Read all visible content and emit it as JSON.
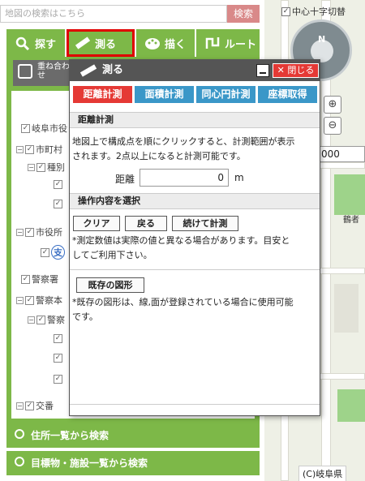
{
  "search": {
    "placeholder": "地図の検索はこちら",
    "button": "検索"
  },
  "map": {
    "cross_toggle": "中心十字切替",
    "compass": "N",
    "input_value": "000",
    "copyright": "(C)岐阜県",
    "place_label": "鶴者"
  },
  "toolbar": {
    "search": "探す",
    "measure": "測る",
    "draw": "描く",
    "route": "ルート"
  },
  "panel": {
    "kasane": "重ね合わせ",
    "hyouji": "表示切",
    "tree": [
      "岐阜市役",
      "市町村",
      "種別",
      "市役所",
      "支",
      "警察署",
      "警察本",
      "警察",
      "交番"
    ]
  },
  "dialog": {
    "title": "測る",
    "close": "閉じる",
    "tabs": [
      "距離計測",
      "面積計測",
      "同心円計測",
      "座標取得"
    ],
    "section1": "距離計測",
    "desc1_line1": "地図上で構成点を順にクリックすると、計測範囲が表示",
    "desc1_line2": "されます。2点以上になると計測可能です。",
    "distance_label": "距離",
    "distance_value": "0",
    "unit": "m",
    "section2": "操作内容を選択",
    "btn_clear": "クリア",
    "btn_back": "戻る",
    "btn_continue": "続けて計測",
    "note1_line1": "*測定数値は実際の値と異なる場合があります。目安と",
    "note1_line2": "してご利用下さい。",
    "btn_existing": "既存の図形",
    "note2_line1": "*既存の図形は、線,面が登録されている場合に使用可能",
    "note2_line2": "です。"
  },
  "bottom": {
    "address": "住所一覧から検索",
    "landmark": "目標物・施設一覧から検索"
  }
}
